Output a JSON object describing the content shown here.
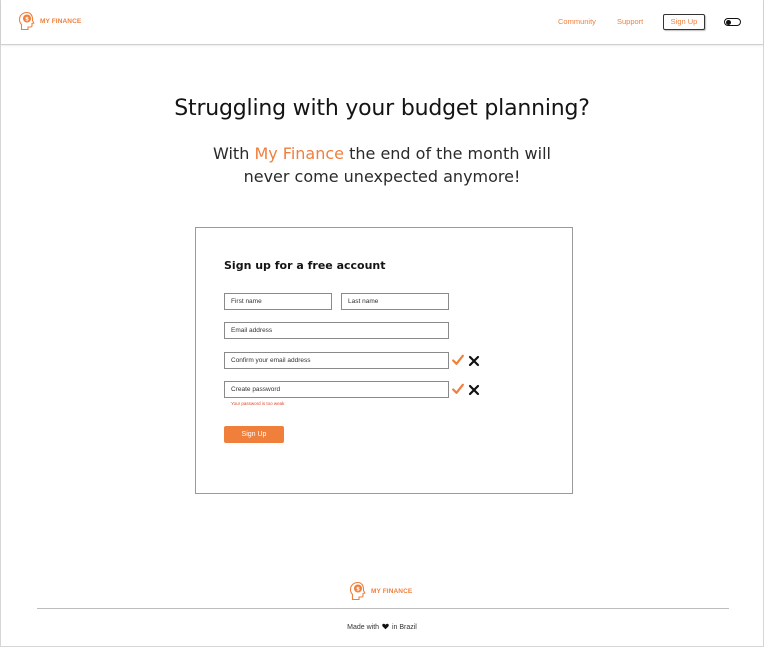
{
  "brand": {
    "name": "MY FINANCE",
    "accent_color": "#f07f3c",
    "icon": "head-coin-icon"
  },
  "nav": {
    "community": "Community",
    "support": "Support",
    "signup": "Sign Up",
    "theme_toggle_icon": "toggle-icon"
  },
  "hero": {
    "title": "Struggling with your budget planning?",
    "subtitle_before": "With ",
    "subtitle_accent": "My Finance",
    "subtitle_line1_after": " the end of the month will",
    "subtitle_line2": "never come unexpected anymore!"
  },
  "form": {
    "title": "Sign up for a free account",
    "first_name_placeholder": "First name",
    "last_name_placeholder": "Last name",
    "email_placeholder": "Email address",
    "confirm_email_placeholder": "Confirm your email address",
    "password_placeholder": "Create password",
    "password_error": "Your password is too weak",
    "submit_label": "Sign Up",
    "valid_icon": "check-icon",
    "invalid_icon": "x-icon",
    "check_color": "#f07f3c",
    "error_color": "#e0442a"
  },
  "footer": {
    "brand_name": "MY FINANCE",
    "made_with": "Made with",
    "heart_icon": "heart-icon",
    "in_brazil": "in Brazil"
  }
}
